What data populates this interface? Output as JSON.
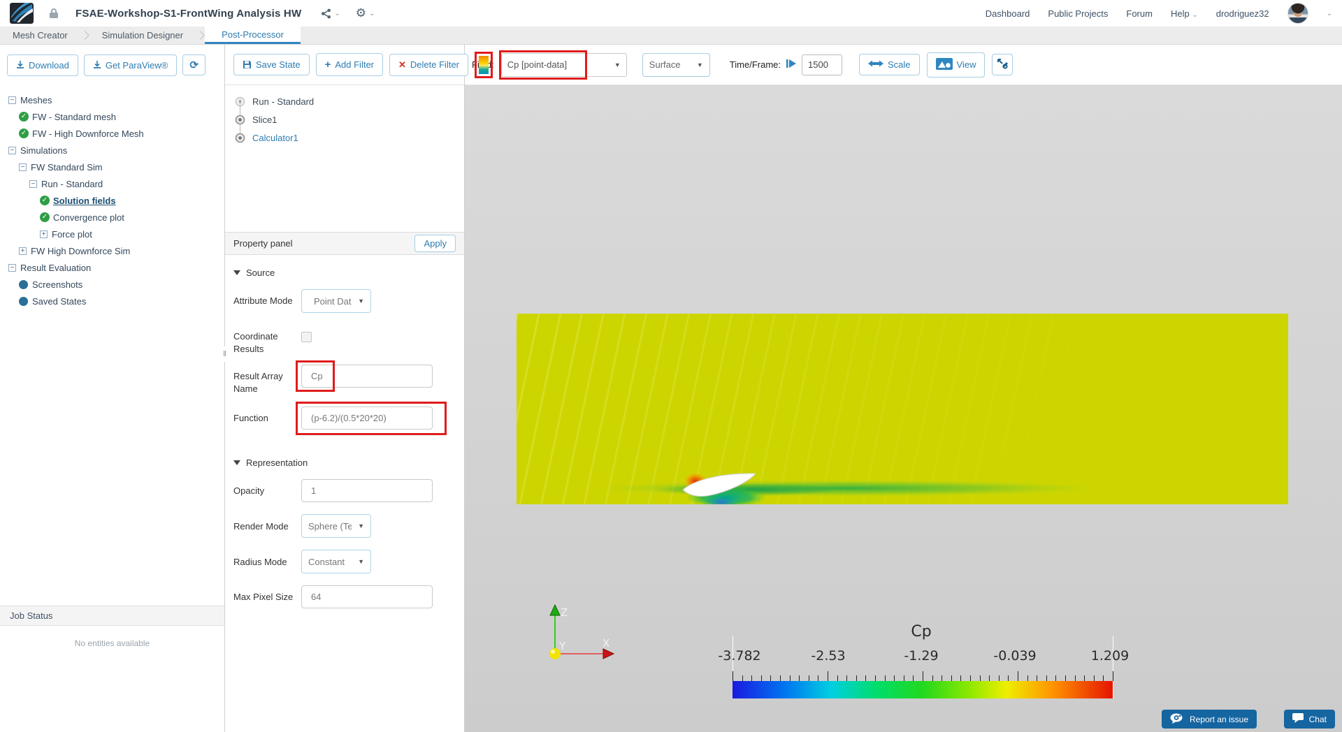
{
  "header": {
    "title": "FSAE-Workshop-S1-FrontWing Analysis HW",
    "nav": {
      "dashboard": "Dashboard",
      "public_projects": "Public Projects",
      "forum": "Forum",
      "help": "Help",
      "username": "drodriguez32"
    }
  },
  "tabs": {
    "mesh_creator": "Mesh Creator",
    "simulation_designer": "Simulation Designer",
    "post_processor": "Post-Processor"
  },
  "sidebar": {
    "download_label": "Download",
    "get_paraview_label": "Get ParaView®",
    "tree": [
      {
        "label": "Meshes",
        "indent": 0,
        "expander": "minus"
      },
      {
        "label": "FW - Standard mesh",
        "indent": 1,
        "icon": "check"
      },
      {
        "label": "FW - High Downforce Mesh",
        "indent": 1,
        "icon": "check"
      },
      {
        "label": "Simulations",
        "indent": 0,
        "expander": "minus"
      },
      {
        "label": "FW Standard Sim",
        "indent": 1,
        "expander": "minus"
      },
      {
        "label": "Run - Standard",
        "indent": 2,
        "expander": "minus"
      },
      {
        "label": "Solution fields",
        "indent": 3,
        "icon": "check",
        "selected": true
      },
      {
        "label": "Convergence plot",
        "indent": 3,
        "icon": "check"
      },
      {
        "label": "Force plot",
        "indent": 3,
        "expander": "plus"
      },
      {
        "label": "FW High Downforce Sim",
        "indent": 1,
        "expander": "plus"
      },
      {
        "label": "Result Evaluation",
        "indent": 0,
        "expander": "minus"
      },
      {
        "label": "Screenshots",
        "indent": 1,
        "icon": "dot"
      },
      {
        "label": "Saved States",
        "indent": 1,
        "icon": "dot"
      }
    ],
    "job_status": {
      "title": "Job Status",
      "empty_message": "No entities available"
    }
  },
  "pipeline": {
    "save_state": "Save State",
    "add_filter": "Add Filter",
    "delete_filter": "Delete Filter",
    "items": [
      {
        "label": "Run - Standard",
        "muted": true
      },
      {
        "label": "Slice1"
      },
      {
        "label": "Calculator1",
        "selected": true
      }
    ]
  },
  "viewport_toolbar": {
    "field_label": "Field:",
    "field_value": "Cp [point-data]",
    "representation_value": "Surface",
    "time_frame_label": "Time/Frame:",
    "time_frame_value": "1500",
    "scale_label": "Scale",
    "view_label": "View"
  },
  "property_panel": {
    "title": "Property panel",
    "apply_label": "Apply",
    "source": {
      "section_label": "Source",
      "attribute_mode_label": "Attribute Mode",
      "attribute_mode_value": "Point Data",
      "coordinate_results_label": "Coordinate Results",
      "result_array_name_label": "Result Array Name",
      "result_array_name_value": "Cp",
      "function_label": "Function",
      "function_value": "(p-6.2)/(0.5*20*20)"
    },
    "representation": {
      "section_label": "Representation",
      "opacity_label": "Opacity",
      "opacity_value": "1",
      "render_mode_label": "Render Mode",
      "render_mode_value": "Sphere (Te",
      "radius_mode_label": "Radius Mode",
      "radius_mode_value": "Constant",
      "max_pixel_size_label": "Max Pixel Size",
      "max_pixel_size_value": "64"
    }
  },
  "viewport": {
    "legend": {
      "title": "Cp",
      "tick_labels": [
        "-3.782",
        "-2.53",
        "-1.29",
        "-0.039",
        "1.209"
      ],
      "gradient_stops": [
        {
          "pos": 0,
          "color": "#1a1ae0"
        },
        {
          "pos": 14,
          "color": "#0077f0"
        },
        {
          "pos": 26,
          "color": "#00cfe0"
        },
        {
          "pos": 38,
          "color": "#00dd6a"
        },
        {
          "pos": 50,
          "color": "#22d81e"
        },
        {
          "pos": 62,
          "color": "#8ae800"
        },
        {
          "pos": 72,
          "color": "#eeee00"
        },
        {
          "pos": 84,
          "color": "#ff9500"
        },
        {
          "pos": 100,
          "color": "#e51400"
        }
      ]
    },
    "axes": {
      "x_label": "X",
      "y_label": "Y",
      "z_label": "Z"
    }
  },
  "footer": {
    "report_issue": "Report an issue",
    "chat": "Chat"
  },
  "colors": {
    "accent_blue": "#2e7cb0",
    "highlight_red": "#e01b1c",
    "check_green": "#2f9e44",
    "contour_yellow": "#cdd501",
    "dark_button_blue": "#1565a0"
  }
}
